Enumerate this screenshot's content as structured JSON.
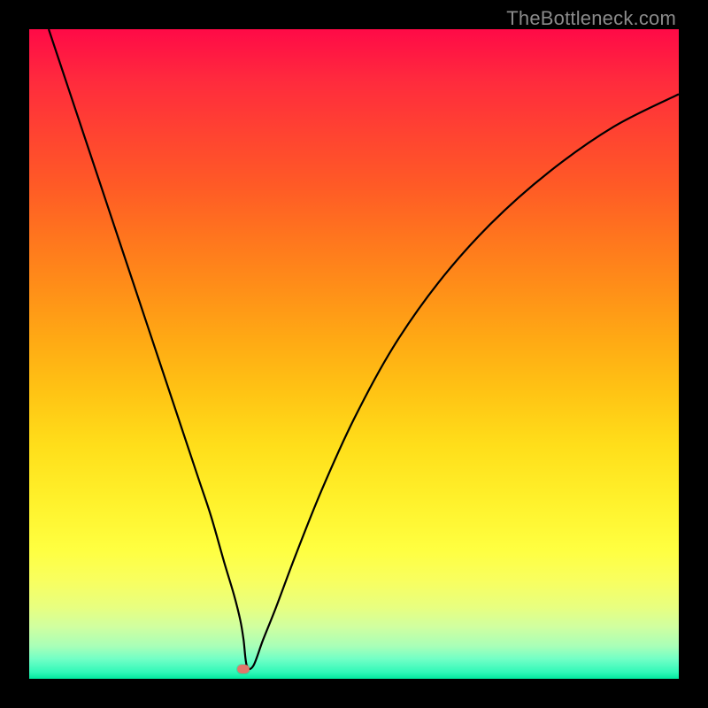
{
  "watermark": "TheBottleneck.com",
  "colors": {
    "frame": "#000000",
    "curve": "#000000",
    "marker": "#e2766a"
  },
  "chart_data": {
    "type": "line",
    "title": "",
    "xlabel": "",
    "ylabel": "",
    "xlim": [
      0,
      100
    ],
    "ylim": [
      0,
      100
    ],
    "grid": false,
    "legend": false,
    "series": [
      {
        "name": "bottleneck-curve",
        "x": [
          3,
          6,
          10,
          14,
          18,
          22,
          26,
          28,
          30,
          31.5,
          32.5,
          33,
          33.5,
          34.5,
          36,
          38,
          41,
          45,
          50,
          56,
          63,
          71,
          80,
          90,
          100
        ],
        "y": [
          100,
          91,
          79,
          67,
          55,
          43,
          31,
          25,
          18,
          13,
          9,
          6,
          2,
          2,
          6,
          11,
          19,
          29,
          40,
          51,
          61,
          70,
          78,
          85,
          90
        ]
      }
    ],
    "marker": {
      "x": 33,
      "y": 1.5
    },
    "background_gradient": {
      "top": "#ff0a47",
      "mid": "#ffde1a",
      "bottom": "#00e89e"
    }
  }
}
